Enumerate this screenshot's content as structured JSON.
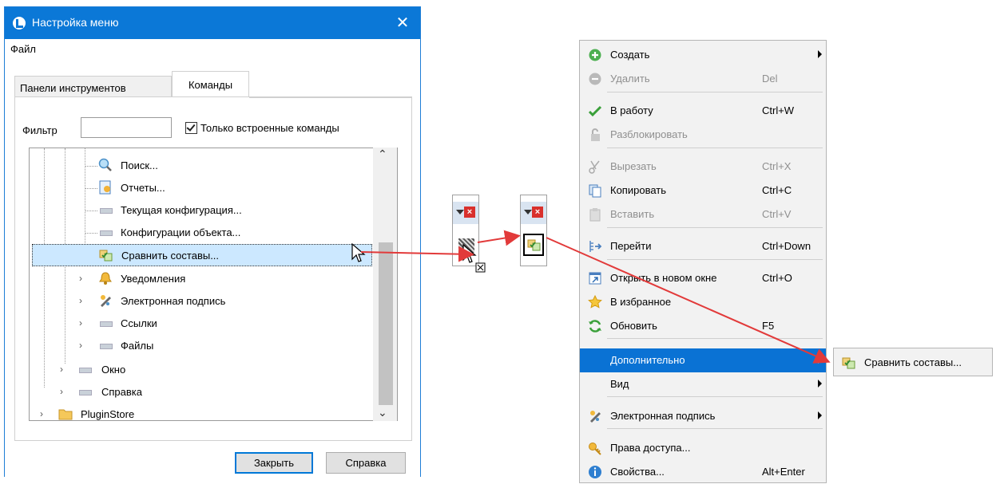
{
  "dialog": {
    "title": "Настройка меню",
    "menu_file": "Файл",
    "tabs": [
      "Панели инструментов",
      "Команды"
    ],
    "filter_label": "Фильтр",
    "filter_value": "",
    "only_builtin_label": "Только встроенные команды",
    "only_builtin_checked": true,
    "tree": [
      {
        "label": "Поиск...",
        "icon": "search-icon"
      },
      {
        "label": "Отчеты...",
        "icon": "report-icon"
      },
      {
        "label": "Текущая конфигурация...",
        "icon": "command-icon"
      },
      {
        "label": "Конфигурации объекта...",
        "icon": "command-icon"
      },
      {
        "label": "Сравнить составы...",
        "icon": "compare-icon",
        "selected": true
      },
      {
        "label": "Уведомления",
        "icon": "notification-icon"
      },
      {
        "label": "Электронная подпись",
        "icon": "signature-icon"
      },
      {
        "label": "Ссылки",
        "icon": "command-icon"
      },
      {
        "label": "Файлы",
        "icon": "command-icon"
      },
      {
        "label": "Окно",
        "icon": "command-icon"
      },
      {
        "label": "Справка",
        "icon": "command-icon"
      },
      {
        "label": "PluginStore",
        "icon": "folder-icon"
      }
    ],
    "close_button": "Закрыть",
    "help_button": "Справка"
  },
  "context_menu": {
    "items": [
      {
        "label": "Создать",
        "shortcut": "",
        "submenu": true,
        "disabled": false,
        "icon": "add-icon"
      },
      {
        "label": "Удалить",
        "shortcut": "Del",
        "submenu": false,
        "disabled": true,
        "icon": "delete-icon"
      },
      {
        "label": "В работу",
        "shortcut": "Ctrl+W",
        "submenu": false,
        "disabled": false,
        "icon": "checkmark-icon"
      },
      {
        "label": "Разблокировать",
        "shortcut": "",
        "submenu": false,
        "disabled": true,
        "icon": "unlock-icon"
      },
      {
        "label": "Вырезать",
        "shortcut": "Ctrl+X",
        "submenu": false,
        "disabled": true,
        "icon": "cut-icon"
      },
      {
        "label": "Копировать",
        "shortcut": "Ctrl+C",
        "submenu": false,
        "disabled": false,
        "icon": "copy-icon"
      },
      {
        "label": "Вставить",
        "shortcut": "Ctrl+V",
        "submenu": false,
        "disabled": true,
        "icon": "paste-icon"
      },
      {
        "label": "Перейти",
        "shortcut": "Ctrl+Down",
        "submenu": false,
        "disabled": false,
        "icon": "goto-icon"
      },
      {
        "label": "Открыть в новом окне",
        "shortcut": "Ctrl+O",
        "submenu": false,
        "disabled": false,
        "icon": "new-window-icon"
      },
      {
        "label": "В избранное",
        "shortcut": "",
        "submenu": false,
        "disabled": false,
        "icon": "star-icon"
      },
      {
        "label": "Обновить",
        "shortcut": "F5",
        "submenu": false,
        "disabled": false,
        "icon": "refresh-icon"
      },
      {
        "label": "Дополнительно",
        "shortcut": "",
        "submenu": true,
        "disabled": false,
        "highlighted": true,
        "icon": ""
      },
      {
        "label": "Вид",
        "shortcut": "",
        "submenu": true,
        "disabled": false,
        "icon": ""
      },
      {
        "label": "Электронная подпись",
        "shortcut": "",
        "submenu": true,
        "disabled": false,
        "icon": "signature-icon"
      },
      {
        "label": "Права доступа...",
        "shortcut": "",
        "submenu": false,
        "disabled": false,
        "icon": "key-icon"
      },
      {
        "label": "Свойства...",
        "shortcut": "Alt+Enter",
        "submenu": false,
        "disabled": false,
        "icon": "info-icon"
      }
    ],
    "submenu_item": "Сравнить составы..."
  },
  "colors": {
    "titlebar": "#0b78d7",
    "selection": "#cce8ff",
    "menu_highlight": "#0a72d4",
    "arrow": "#e23a3a"
  }
}
